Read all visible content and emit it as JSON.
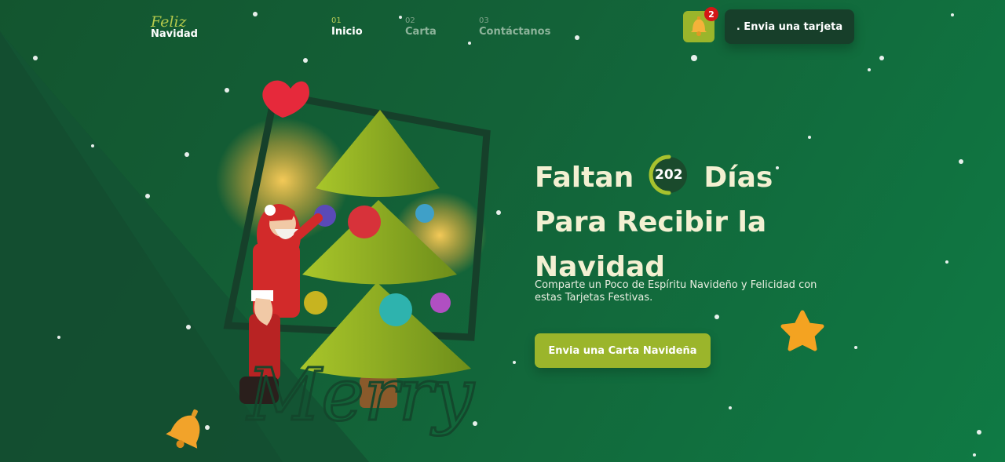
{
  "logo": {
    "script": "Feliz",
    "main": "Navidad"
  },
  "nav": [
    {
      "num": "01",
      "label": "Inicio"
    },
    {
      "num": "02",
      "label": "Carta"
    },
    {
      "num": "03",
      "label": "Contáctanos"
    }
  ],
  "notifications": {
    "count": "2",
    "icon": "bell-icon"
  },
  "header": {
    "cta_label": ". Envia una tarjeta"
  },
  "hero": {
    "title_word1": "Faltan",
    "days": "202",
    "title_word2": "Días",
    "title_line2": "Para Recibir la",
    "title_line3": "Navidad",
    "subtitle": "Comparte un Poco de Espíritu Navideño y Felicidad con estas Tarjetas Festivas.",
    "cta_label": "Envia una Carta Navideña"
  },
  "illustration": {
    "merry_text": "Merry"
  },
  "colors": {
    "accent": "#9bb52b",
    "dark": "#173f2a",
    "title": "#f3f0d2",
    "badge": "#d31717"
  }
}
